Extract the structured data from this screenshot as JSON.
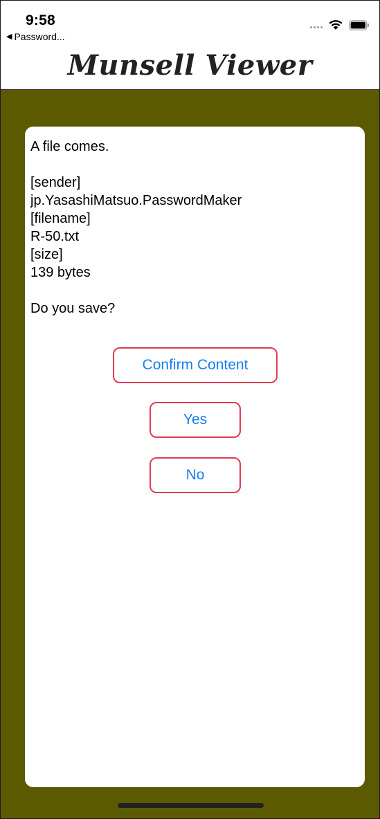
{
  "status_bar": {
    "time": "9:58",
    "back_label": "Password..."
  },
  "header": {
    "title": "Munsell Viewer"
  },
  "dialog": {
    "lines": {
      "intro": "A file comes.",
      "sender_label": "[sender]",
      "sender_value": "jp.YasashiMatsuo.PasswordMaker",
      "filename_label": "[filename]",
      "filename_value": "R-50.txt",
      "size_label": "[size]",
      "size_value": "139 bytes",
      "question": "Do you save?"
    },
    "buttons": {
      "confirm": "Confirm Content",
      "yes": "Yes",
      "no": "No"
    }
  },
  "colors": {
    "background": "#5c5a00",
    "button_border": "#e03a55",
    "button_text": "#1a7cf0"
  }
}
